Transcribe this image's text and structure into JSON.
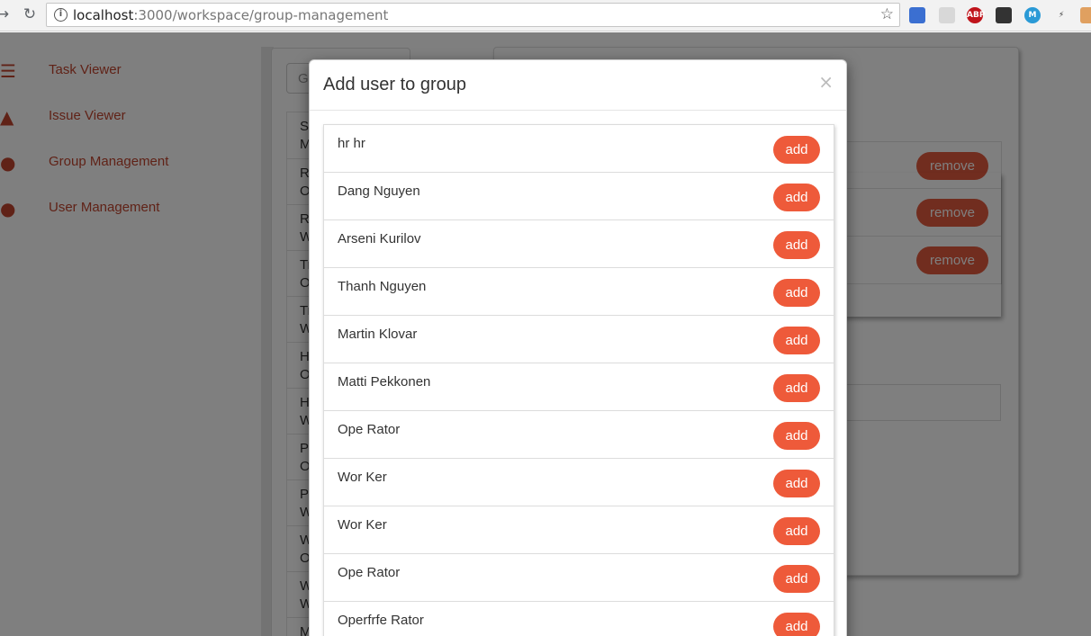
{
  "browser": {
    "url_host": "localhost",
    "url_path": ":3000/workspace/group-management"
  },
  "sidebar": {
    "items": [
      {
        "label": "Task Viewer",
        "icon": "list-icon"
      },
      {
        "label": "Issue Viewer",
        "icon": "warning-icon"
      },
      {
        "label": "Group Management",
        "icon": "group-icon"
      },
      {
        "label": "User Management",
        "icon": "user-icon"
      }
    ]
  },
  "groups": {
    "search_placeholder": "G",
    "rows": [
      {
        "line1": "Sa",
        "line2": "M"
      },
      {
        "line1": "Ra",
        "line2": "O"
      },
      {
        "line1": "Ra",
        "line2": "W"
      },
      {
        "line1": "Tr",
        "line2": "O"
      },
      {
        "line1": "Tr",
        "line2": "W"
      },
      {
        "line1": "H",
        "line2": "O"
      },
      {
        "line1": "H",
        "line2": "W"
      },
      {
        "line1": "Pa",
        "line2": "O"
      },
      {
        "line1": "Pa",
        "line2": "W"
      },
      {
        "line1": "W",
        "line2": "O"
      },
      {
        "line1": "W",
        "line2": "W"
      },
      {
        "line1": "M",
        "line2": ""
      }
    ]
  },
  "members": {
    "remove_label": "remove"
  },
  "modal": {
    "title": "Add user to group",
    "close_glyph": "×",
    "add_label": "add",
    "users": [
      "hr hr",
      "Dang Nguyen",
      "Arseni Kurilov",
      "Thanh Nguyen",
      "Martin Klovar",
      "Matti Pekkonen",
      "Ope Rator",
      "Wor Ker",
      "Wor Ker",
      "Ope Rator",
      "Operfrfe Rator"
    ]
  },
  "colors": {
    "accent": "#ee5a3a",
    "sidebar_link": "#c0452e"
  }
}
